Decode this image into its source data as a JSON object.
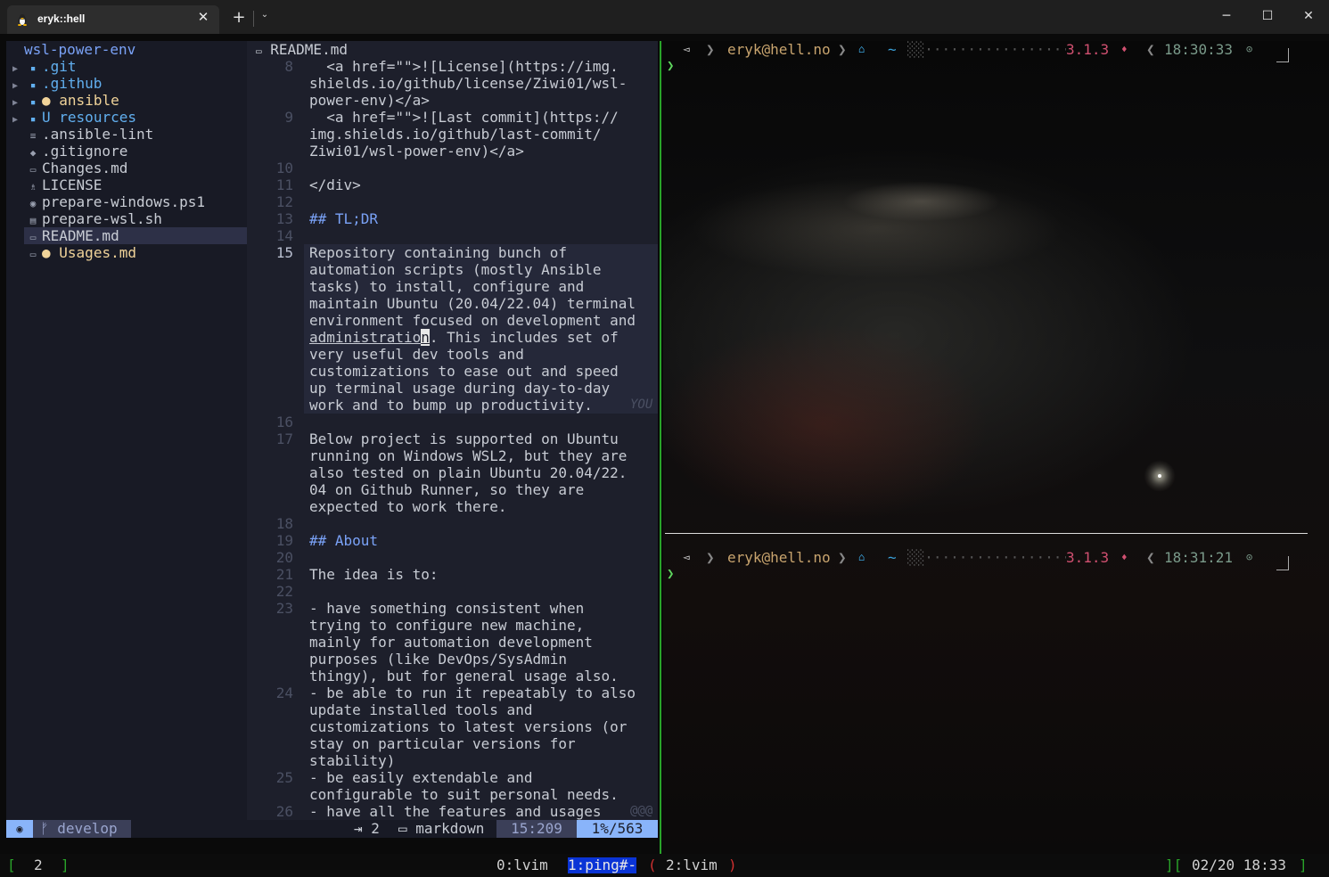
{
  "window": {
    "tab_title": "eryk::hell",
    "tab_close": "✕",
    "new_tab": "+",
    "tab_menu": "⌄",
    "minimize": "─",
    "maximize": "☐",
    "close": "✕"
  },
  "tree": {
    "root": "wsl-power-env",
    "items": [
      {
        "arrow": "▶",
        "icon": "▪",
        "label": ".git",
        "color": "#61afef"
      },
      {
        "arrow": "▶",
        "icon": "▪",
        "label": ".github",
        "color": "#61afef"
      },
      {
        "arrow": "▶",
        "icon": "▪",
        "label": "ansible",
        "color": "#f0d399",
        "mark": "●"
      },
      {
        "arrow": "▶",
        "icon": "▪",
        "label": "resources",
        "color": "#61afef",
        "mark": "U"
      },
      {
        "arrow": "",
        "icon": "≡",
        "label": ".ansible-lint",
        "color": "#c8ccd4"
      },
      {
        "arrow": "",
        "icon": "◆",
        "label": ".gitignore",
        "color": "#c8ccd4"
      },
      {
        "arrow": "",
        "icon": "▭",
        "label": "Changes.md",
        "color": "#c8ccd4"
      },
      {
        "arrow": "",
        "icon": "♗",
        "label": "LICENSE",
        "color": "#c8ccd4"
      },
      {
        "arrow": "",
        "icon": "◉",
        "label": "prepare-windows.ps1",
        "color": "#c8ccd4"
      },
      {
        "arrow": "",
        "icon": "▤",
        "label": "prepare-wsl.sh",
        "color": "#c8ccd4"
      },
      {
        "arrow": "",
        "icon": "▭",
        "label": "README.md",
        "color": "#c8ccd4"
      },
      {
        "arrow": "",
        "icon": "▭",
        "label": "Usages.md",
        "color": "#f0d399",
        "mark": "●"
      }
    ]
  },
  "editor": {
    "filename": "README.md",
    "lines": [
      {
        "n": "8",
        "text": "  <a href=\"\">![License](https://img.\nshields.io/github/license/Ziwi01/wsl-\npower-env)</a>"
      },
      {
        "n": "9",
        "text": "  <a href=\"\">![Last commit](https://\nimg.shields.io/github/last-commit/\nZiwi01/wsl-power-env)</a>"
      },
      {
        "n": "10",
        "text": ""
      },
      {
        "n": "11",
        "text": "</div>"
      },
      {
        "n": "12",
        "text": ""
      },
      {
        "n": "13",
        "text": "## TL;DR",
        "heading": true
      },
      {
        "n": "14",
        "text": ""
      },
      {
        "n": "15",
        "text": "Repository containing bunch of\nautomation scripts (mostly Ansible\ntasks) to install, configure and\nmaintain Ubuntu (20.04/22.04) terminal\nenvironment focused on development and\nadministration. This includes set of\nvery useful dev tools and\ncustomizations to ease out and speed\nup terminal usage during day-to-day\nwork and to bump up productivity.",
        "current": true
      },
      {
        "n": "16",
        "text": ""
      },
      {
        "n": "17",
        "text": "Below project is supported on Ubuntu\nrunning on Windows WSL2, but they are\nalso tested on plain Ubuntu 20.04/22.\n04 on Github Runner, so they are\nexpected to work there."
      },
      {
        "n": "18",
        "text": ""
      },
      {
        "n": "19",
        "text": "## About",
        "heading": true
      },
      {
        "n": "20",
        "text": ""
      },
      {
        "n": "21",
        "text": "The idea is to:"
      },
      {
        "n": "22",
        "text": ""
      },
      {
        "n": "23",
        "text": "- have something consistent when\ntrying to configure new machine,\nmainly for automation development\npurposes (like DevOps/SysAdmin\nthingy), but for general usage also."
      },
      {
        "n": "24",
        "text": "- be able to run it repeatably to also\nupdate installed tools and\ncustomizations to latest versions (or\nstay on particular versions for\nstability)"
      },
      {
        "n": "25",
        "text": "- be easily extendable and\nconfigurable to suit personal needs."
      },
      {
        "n": "26",
        "text": "- have all the features and usages"
      }
    ],
    "cursor_word_before": "administratio",
    "cursor_char": "n",
    "virtual_text": "YOU",
    "overflow_marker": "@@@"
  },
  "statusline": {
    "mode_icon": "◉",
    "branch": "ᚠ develop",
    "indent": "⇥ 2",
    "filetype": "▭ markdown",
    "position": "15:209",
    "percent": "1%/563"
  },
  "shell": {
    "prompts": [
      {
        "os": "◅",
        "user": "eryk@hell.no",
        "home": "⌂",
        "dir": "~",
        "ruby": "3.1.3",
        "gem": "♦",
        "time": "18:30:33",
        "clock": "⊙"
      },
      {
        "os": "◅",
        "user": "eryk@hell.no",
        "home": "⌂",
        "dir": "~",
        "ruby": "3.1.3",
        "gem": "♦",
        "time": "18:31:21",
        "clock": "⊙"
      }
    ],
    "fill": "░░·······················░░░",
    "caret": "❯",
    "chevron": "❯",
    "chevron_left": "❮"
  },
  "tmux": {
    "session_open": "[",
    "session": "2",
    "session_close": "]",
    "windows": [
      {
        "label": "0:lvim",
        "active": false
      },
      {
        "label": "1:ping#-",
        "active": true
      },
      {
        "label": "2:lvim",
        "active": false
      }
    ],
    "paren_open": "(",
    "paren_close": ")",
    "date_open": "][",
    "date": "02/20 18:33",
    "date_close": "]"
  }
}
